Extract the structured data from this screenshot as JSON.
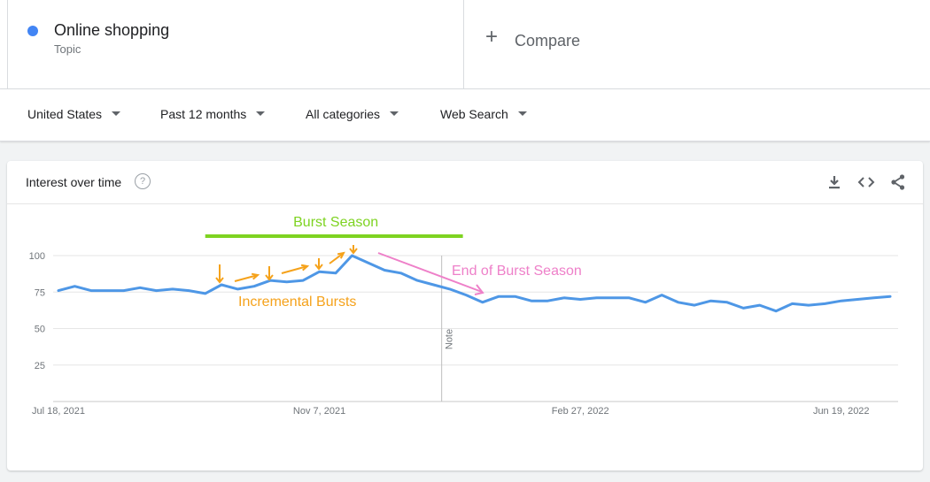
{
  "term": {
    "title": "Online shopping",
    "subtitle": "Topic",
    "color": "#4285f4"
  },
  "compare": {
    "label": "Compare"
  },
  "filters": {
    "region": "United States",
    "time": "Past 12 months",
    "category": "All categories",
    "search_type": "Web Search"
  },
  "card": {
    "title": "Interest over time",
    "help": "?"
  },
  "icons": [
    "download-icon",
    "embed-icon",
    "share-icon",
    "help-icon",
    "plus-icon"
  ],
  "chart_data": {
    "type": "line",
    "title": "",
    "xlabel": "",
    "ylabel": "",
    "ylim": [
      0,
      100
    ],
    "grid": true,
    "y_ticks": [
      100,
      75,
      50,
      25
    ],
    "x_ticks": [
      {
        "label": "Jul 18, 2021",
        "index": 0
      },
      {
        "label": "Nov 7, 2021",
        "index": 16
      },
      {
        "label": "Feb 27, 2022",
        "index": 32
      },
      {
        "label": "Jun 19, 2022",
        "index": 48
      }
    ],
    "series": [
      {
        "color": "#4e97e6",
        "values": [
          76,
          79,
          76,
          76,
          76,
          78,
          76,
          77,
          76,
          74,
          80,
          77,
          79,
          83,
          82,
          83,
          89,
          88,
          100,
          95,
          90,
          88,
          83,
          80,
          77,
          73,
          68,
          72,
          72,
          69,
          69,
          71,
          70,
          71,
          71,
          71,
          68,
          73,
          68,
          66,
          69,
          68,
          64,
          66,
          62,
          67,
          66,
          67,
          69,
          70,
          71,
          72
        ]
      }
    ],
    "note_marker": {
      "label": "Note",
      "index": 23.5
    },
    "annotations": {
      "burst_season": {
        "label": "Burst Season",
        "color": "#7ed321",
        "from_index": 9,
        "to_index": 24.8
      },
      "incremental_bursts": {
        "label": "Incremental Bursts",
        "color": "#f5a21b"
      },
      "end_of_burst": {
        "label": "End of Burst Season",
        "color": "#ee80c9"
      }
    }
  }
}
